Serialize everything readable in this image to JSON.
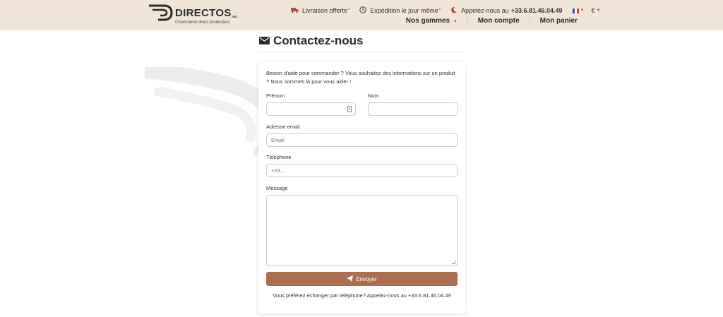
{
  "header": {
    "logo": {
      "brand": "DIRECTOS",
      "brand_suffix": ".eu",
      "tagline": "Charcuterie direct producteur"
    },
    "topbar": {
      "delivery": {
        "label": "Livraison offerte",
        "mark": "*",
        "icon": "truck-icon"
      },
      "shipping": {
        "label": "Expédition le jour même",
        "mark": "*",
        "icon": "clock-icon"
      },
      "phone": {
        "prefix": "Appelez-nous au",
        "number": "+33.6.81.46.04.49",
        "icon": "moon-icon"
      },
      "language": {
        "icon": "french-flag-icon"
      },
      "currency": {
        "label": "€"
      }
    },
    "nav": [
      {
        "label": "Nos gammes",
        "has_caret": true
      },
      {
        "label": "Mon compte"
      },
      {
        "label": "Mon panier"
      }
    ]
  },
  "page": {
    "title": "Contactez-nous",
    "title_icon": "envelope-icon"
  },
  "form": {
    "intro": "Besoin d'aide pour commander ? Vous souhaitez des informations sur un produit ? Nous sommes là pour vous aider !",
    "firstname": {
      "label": "Prénom",
      "value": "",
      "placeholder": ""
    },
    "lastname": {
      "label": "Nom",
      "value": "",
      "placeholder": ""
    },
    "email": {
      "label": "Adresse email",
      "value": "",
      "placeholder": "Email"
    },
    "phone": {
      "label": "Téléphone",
      "value": "",
      "placeholder": "+33..."
    },
    "message": {
      "label": "Message",
      "value": ""
    },
    "submit": {
      "label": "Envoyer",
      "icon": "paper-plane-icon"
    },
    "footer_note": "Vous préférez échanger par téléphone? Appelez-nous au +33.6.81.46.04.49"
  },
  "colors": {
    "header_bg": "#f1e5d8",
    "accent": "#ac6e4f",
    "caret": "#b5523b"
  }
}
